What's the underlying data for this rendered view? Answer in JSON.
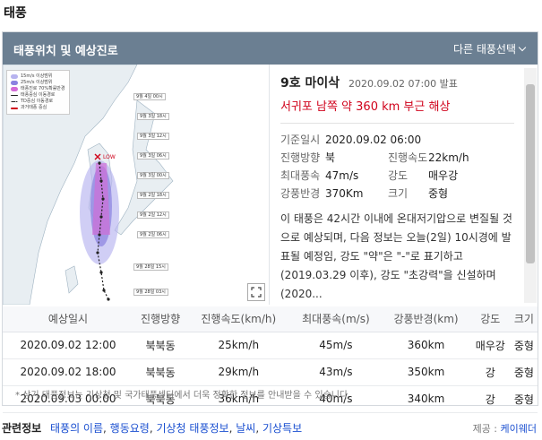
{
  "page_title": "태풍",
  "header": {
    "title": "태풍위치 및 예상진로",
    "select_label": "다른 태풍선택"
  },
  "storm": {
    "name": "9호 마이삭",
    "issued": "2020.09.02 07:00 발표",
    "location": "서귀포 남쪽 약 360 km 부근 해상",
    "base_time_label": "기준일시",
    "base_time": "2020.09.02 06:00",
    "direction_label": "진행방향",
    "direction": "북",
    "speed_label": "진행속도",
    "speed": "22km/h",
    "max_wind_label": "최대풍속",
    "max_wind": "47m/s",
    "intensity_label": "강도",
    "intensity": "매우강",
    "radius_label": "강풍반경",
    "radius": "370Km",
    "size_label": "크기",
    "size": "중형",
    "description": "이 태풍은 42시간 이내에 온대저기압으로 변질될 것으로 예상되며, 다음 정보는 오늘(2일) 10시경에 발표될 예정임, 강도 \"약\"은 \"-\"로 표기하고 (2019.03.29 이후), 강도 \"초강력\"을 신설하며 (2020..."
  },
  "map": {
    "legend": [
      "15m/s 이상범위",
      "25m/s 이상범위",
      "태풍진로 70%확률반경",
      "태풍중심 이동경로",
      "TD중심 이동경로",
      "과거태풍 중심"
    ],
    "low_label": "LOW",
    "labels": [
      "9월 4일 00시",
      "9월 3일 18시",
      "9월 3일 12시",
      "9월 3일 06시",
      "9월 3일 00시",
      "9월 2일 18시",
      "9월 2일 12시",
      "9월 2일 06시",
      "9월 28일 15시",
      "9월 28일 03시"
    ],
    "colors": {
      "sea": "#ffffff",
      "land": "#e8eef2",
      "track": "#222222",
      "wind15": "#b7b3ef",
      "wind25": "#8a82e0",
      "prob": "#d36ad6"
    }
  },
  "table": {
    "headers": [
      "예상일시",
      "진행방향",
      "진행속도(km/h)",
      "최대풍속(m/s)",
      "강풍반경(km)",
      "강도",
      "크기"
    ],
    "rows": [
      [
        "2020.09.02 12:00",
        "북북동",
        "25km/h",
        "45m/s",
        "360km",
        "매우강",
        "중형"
      ],
      [
        "2020.09.02 18:00",
        "북북동",
        "29km/h",
        "43m/s",
        "350km",
        "강",
        "중형"
      ],
      [
        "2020.09.03 00:00",
        "북북동",
        "36km/h",
        "40m/s",
        "340km",
        "강",
        "중형"
      ]
    ]
  },
  "footnote": "* 상기 태풍정보는 기상청 및 국가태풍센터에서 더욱 정확한 정보를 안내받을 수 있습니다.",
  "related": {
    "label": "관련정보",
    "links": [
      "태풍의 이름",
      "행동요령",
      "기상청 태풍정보",
      "날씨",
      "기상특보"
    ]
  },
  "source": {
    "label": "제공 : ",
    "name": "케이웨더"
  }
}
